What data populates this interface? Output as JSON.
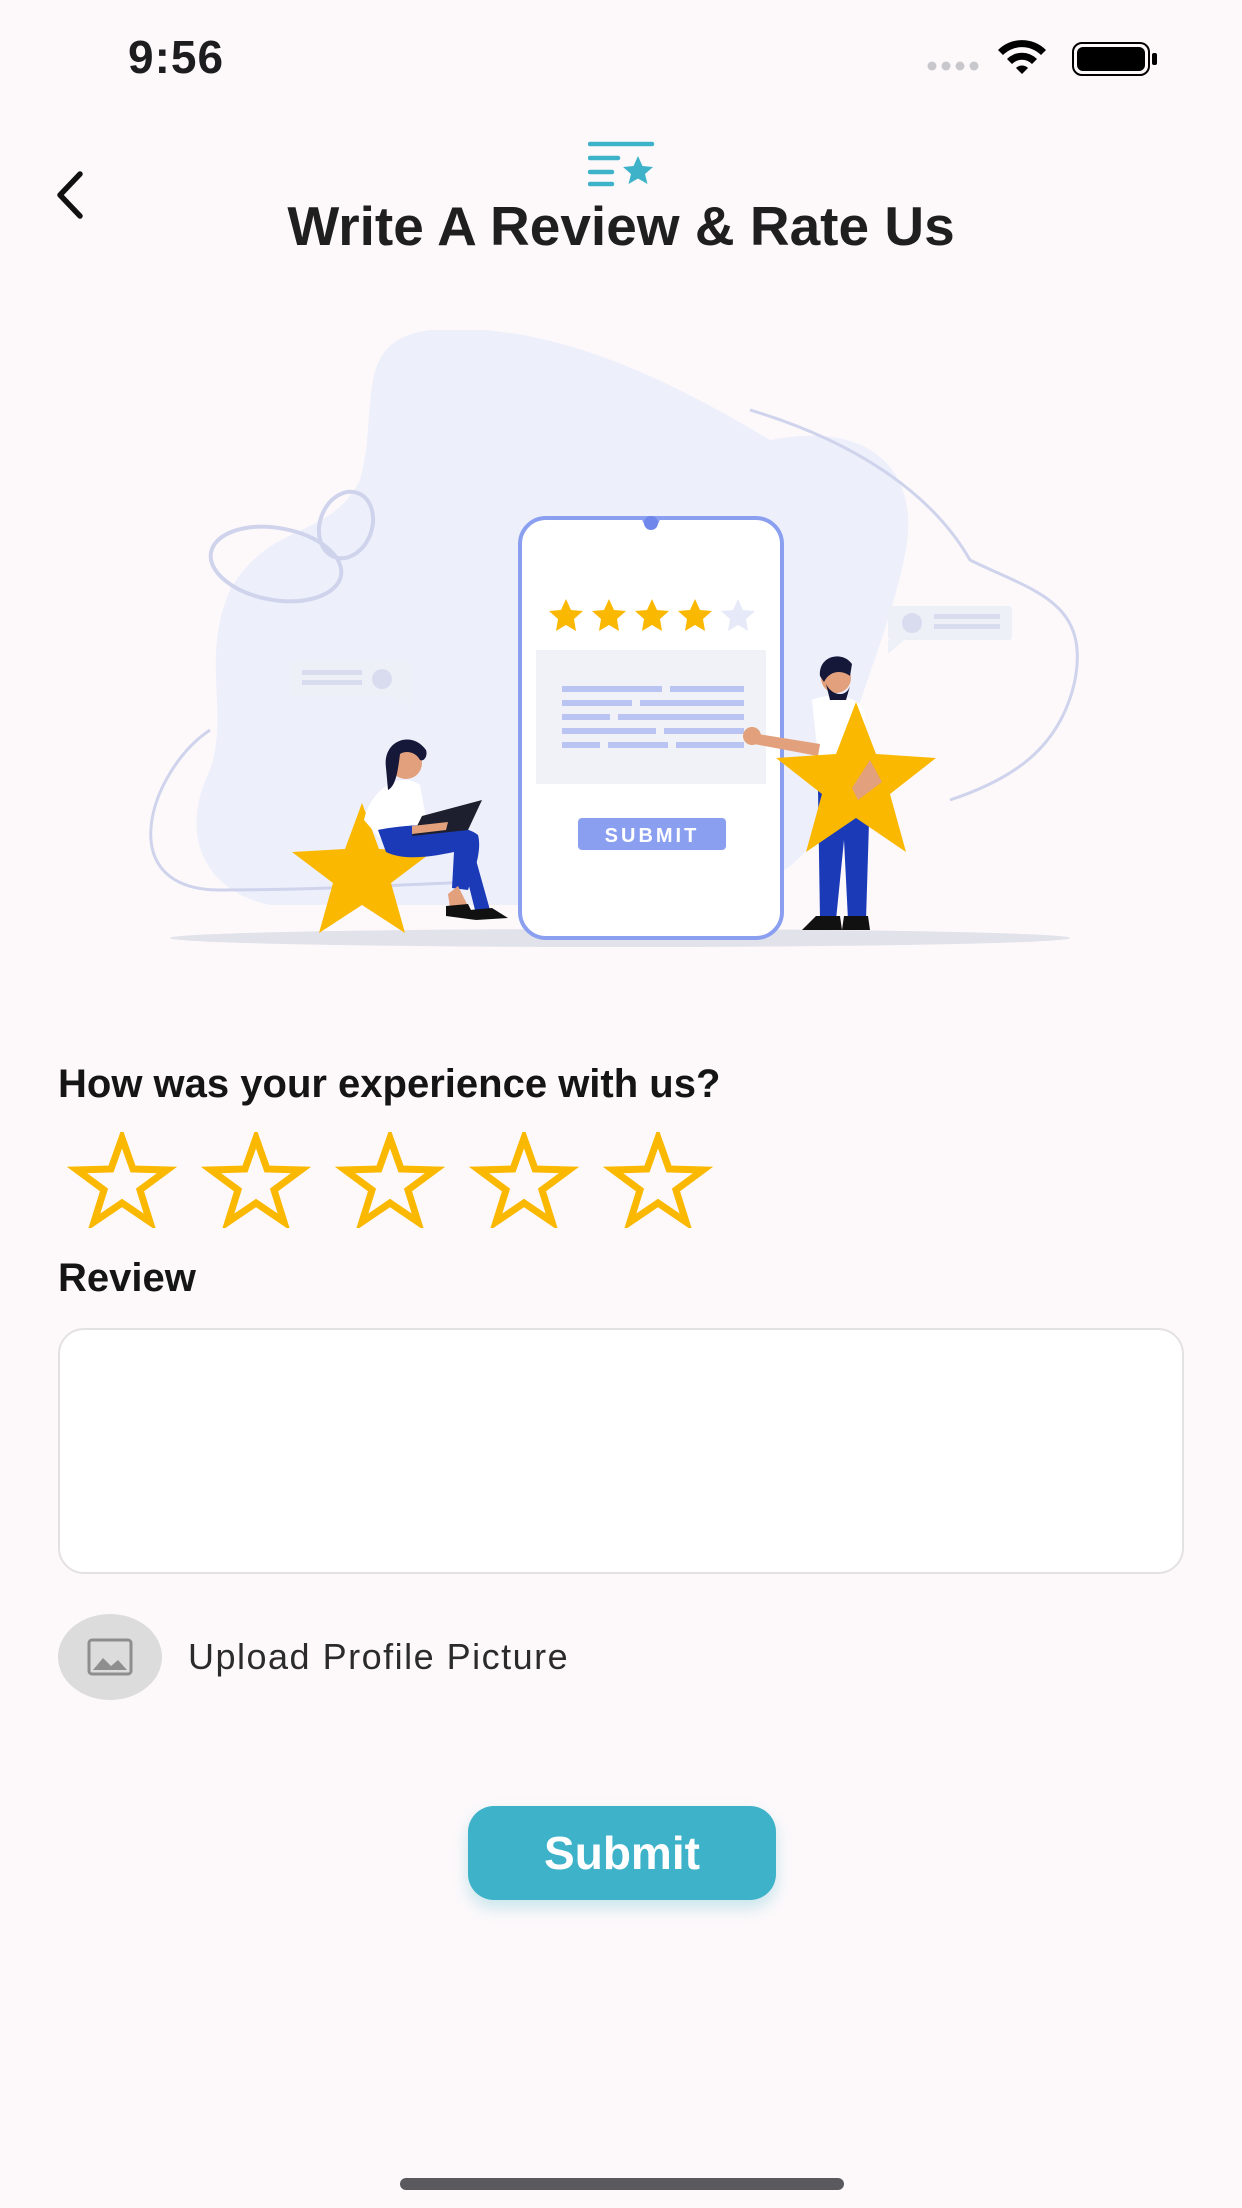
{
  "status_bar": {
    "time": "9:56"
  },
  "header": {
    "title": "Write A Review & Rate Us"
  },
  "illustration": {
    "phone_button_label": "SUBMIT",
    "phone_rating": 4
  },
  "form": {
    "question": "How was your experience with us?",
    "rating": 0,
    "rating_max": 5,
    "review_label": "Review",
    "review_value": "",
    "upload_label": "Upload Profile Picture",
    "submit_label": "Submit"
  },
  "colors": {
    "accent": "#3db2c9",
    "star": "#fbb800",
    "background": "#fdf9fb",
    "illustration_blob": "#edeffb",
    "phone_outline": "#8a9ff0",
    "figure_blue": "#1b3ab7"
  },
  "icons": {
    "back": "chevron-left-icon",
    "title": "review-list-star-icon",
    "upload": "image-placeholder-icon",
    "rating": "star-outline-icon"
  }
}
